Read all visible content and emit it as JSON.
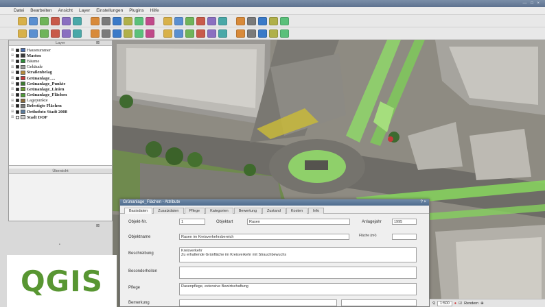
{
  "window": {
    "title": "",
    "controls": "— □ ×"
  },
  "menu": [
    "Datei",
    "Bearbeiten",
    "Ansicht",
    "Layer",
    "Einstellungen",
    "Plugins",
    "Hilfe"
  ],
  "toolbar1_icons": [
    "new-project-icon",
    "open-icon",
    "save-icon",
    "save-as-icon",
    "print-icon",
    "pan-icon",
    "zoom-in-icon",
    "zoom-out-icon",
    "zoom-full-icon",
    "refresh-icon",
    "identify-icon",
    "select-icon",
    "deselect-icon",
    "measure-icon",
    "annotation-icon",
    "label-icon",
    "digitize-icon",
    "edit-icon",
    "node-icon",
    "move-icon",
    "undo-icon",
    "redo-icon",
    "help-icon"
  ],
  "toolbar2_icons": [
    "add-vector-icon",
    "add-raster-icon",
    "add-postgis-icon",
    "add-wms-icon",
    "add-wfs-icon",
    "add-csv-icon",
    "new-layer-icon",
    "remove-layer-icon",
    "plugin-icon",
    "python-icon",
    "grass-icon",
    "georef-icon",
    "gps-icon",
    "table-icon",
    "chart-icon",
    "globe-icon",
    "osm-icon",
    "delimited-icon",
    "spatial-query-icon",
    "heatmap-icon",
    "topology-icon",
    "print-composer-icon",
    "help-icon"
  ],
  "layers_panel": {
    "title": "Layer",
    "items": [
      {
        "name": "Hausnummer",
        "checked": true,
        "bold": false,
        "color": "#4a6fb0"
      },
      {
        "name": "Masten",
        "checked": true,
        "bold": true,
        "color": "#3a3a3a"
      },
      {
        "name": "Bäume",
        "checked": true,
        "bold": false,
        "color": "#2e8b3a"
      },
      {
        "name": "Gebäude",
        "checked": true,
        "bold": false,
        "color": "#9a9a9a"
      },
      {
        "name": "Straßenbelag",
        "checked": true,
        "bold": true,
        "color": "#b58a3c"
      },
      {
        "name": "Grünanlage_...",
        "checked": true,
        "bold": true,
        "color": "#c43a3a"
      },
      {
        "name": "Grünanlage_Punkte",
        "checked": true,
        "bold": true,
        "color": "#3c7a30"
      },
      {
        "name": "Grünanlage_Linien",
        "checked": true,
        "bold": true,
        "color": "#6a9a30"
      },
      {
        "name": "Grünanlage_Flächen",
        "checked": true,
        "bold": true,
        "color": "#4f9a3a"
      },
      {
        "name": "Lagepunkte",
        "checked": true,
        "bold": false,
        "color": "#8a6a3a"
      },
      {
        "name": "Befestigte Flächen",
        "checked": true,
        "bold": true,
        "color": "#7a7a7a"
      },
      {
        "name": "Orthofoto Stadt 2008",
        "checked": true,
        "bold": true,
        "color": "#5a7a9a"
      },
      {
        "name": "Stadt DOP",
        "checked": false,
        "bold": true,
        "color": "#cccccc"
      }
    ],
    "second_panel_title": "Übersicht"
  },
  "dialog": {
    "title": "Grünanlage_Flächen - Attribute",
    "tabs": [
      "Basisdaten",
      "Zusatzdaten",
      "Pflege",
      "Kategorien",
      "Bewertung",
      "Zustand",
      "Kosten",
      "Info"
    ],
    "fields": {
      "label1": "Objekt-Nr.",
      "value1": "1",
      "label1b": "Objektart",
      "value1b": "Rasen",
      "label1c": "Anlagejahr",
      "value1c": "1995",
      "label2": "Objektname",
      "value2": "Rasen im Kreisverkehrsbereich",
      "label2b": "Fläche (m²)",
      "label3": "Beschreibung",
      "value3": "Kreisverkehr\nZu erhaltende Grünfläche im Kreisverkehr mit Strauchbewuchs",
      "label4": "Besonderheiten",
      "label5": "Pflege",
      "value5": "Rasenpflege, extensive Bewirtschaftung",
      "label6": "Bemerkung"
    }
  },
  "statusbar": {
    "scale": "1:500",
    "render_label": "Rendern"
  },
  "logo": {
    "text": "QGIS",
    "color": "#589632"
  }
}
